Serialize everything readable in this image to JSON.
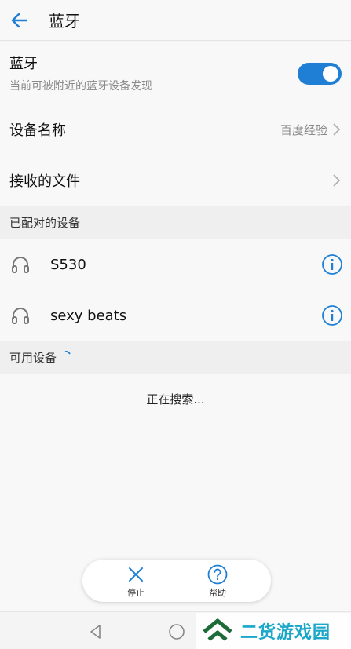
{
  "header": {
    "title": "蓝牙",
    "back_icon": "arrow-left-icon"
  },
  "bluetooth": {
    "title": "蓝牙",
    "subtitle": "当前可被附近的蓝牙设备发现",
    "enabled": true,
    "accent_color": "#1f7fd4"
  },
  "settings": {
    "device_name_label": "设备名称",
    "device_name_value": "百度经验",
    "received_files_label": "接收的文件"
  },
  "paired": {
    "header": "已配对的设备",
    "devices": [
      {
        "name": "S530",
        "icon": "headphones-icon"
      },
      {
        "name": "sexy beats",
        "icon": "headphones-icon"
      }
    ]
  },
  "available": {
    "header": "可用设备",
    "status": "正在搜索..."
  },
  "floating_bar": {
    "stop_label": "停止",
    "help_label": "帮助"
  },
  "watermark": {
    "text": "二货游戏园"
  }
}
